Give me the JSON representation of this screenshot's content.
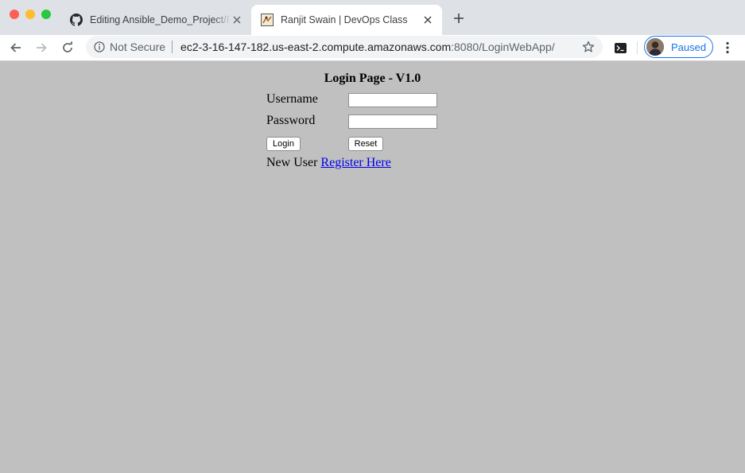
{
  "browser": {
    "tabs": [
      {
        "title": "Editing Ansible_Demo_Project/README.md",
        "active": false,
        "icon": "github-icon"
      },
      {
        "title": "Ranjit Swain | DevOps Class",
        "active": true,
        "icon": "site-favicon"
      }
    ],
    "security_label": "Not Secure",
    "url_host": "ec2-3-16-147-182.us-east-2.compute.amazonaws.com",
    "url_rest": ":8080/LoginWebApp/",
    "profile_status": "Paused"
  },
  "login": {
    "title": "Login Page - V1.0",
    "username_label": "Username",
    "username_value": "",
    "password_label": "Password",
    "password_value": "",
    "login_button": "Login",
    "reset_button": "Reset",
    "new_user_text": "New User",
    "register_link": "Register Here"
  }
}
